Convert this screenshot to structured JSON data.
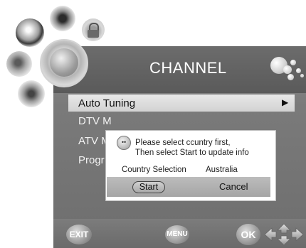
{
  "header": {
    "title": "CHANNEL"
  },
  "menu": {
    "items": [
      {
        "label": "Auto Tuning"
      },
      {
        "label": "DTV M"
      },
      {
        "label": "ATV M"
      },
      {
        "label": "Progr"
      }
    ],
    "selected_arrow": "▶"
  },
  "dialog": {
    "message_line1": "Please select ccuntry first,",
    "message_line2": "Then select Start to update info",
    "country_label": "Country Selection",
    "country_value": "Australia",
    "start_label": "Start",
    "cancel_label": "Cancel"
  },
  "bottom": {
    "exit_label": "EXIT",
    "menu_label": "MENU",
    "ok_label": "OK"
  },
  "icons": [
    "dvd-icon",
    "gear-icon",
    "lock-icon",
    "wrench-icon",
    "palette-icon",
    "channel-globe-icon",
    "bubbles-icon",
    "dpad-icon",
    "dialog-info-icon"
  ],
  "colors": {
    "panel": "#7a7a7a",
    "selected_row": "#dcdcdc",
    "dialog_bg": "#ffffff"
  }
}
